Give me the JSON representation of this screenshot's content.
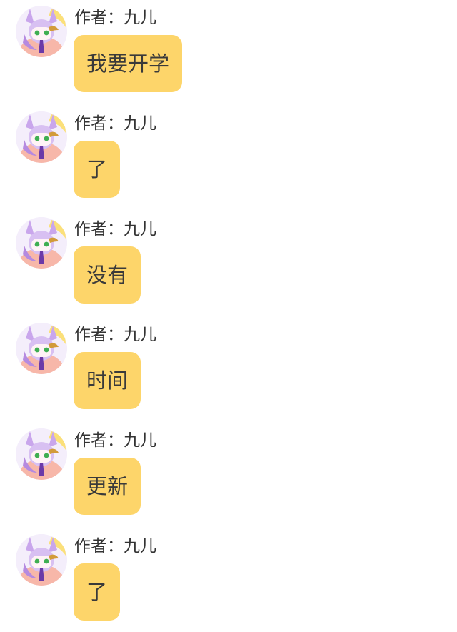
{
  "chat": {
    "messages": [
      {
        "author": "作者：九儿",
        "text": "我要开学"
      },
      {
        "author": "作者：九儿",
        "text": "了"
      },
      {
        "author": "作者：九儿",
        "text": "没有"
      },
      {
        "author": "作者：九儿",
        "text": "时间"
      },
      {
        "author": "作者：九儿",
        "text": "更新"
      },
      {
        "author": "作者：九儿",
        "text": "了"
      }
    ]
  },
  "colors": {
    "bubble": "#fdd56a",
    "author_text": "#333333",
    "bubble_text": "#3a3a3a",
    "background": "#ffffff"
  },
  "icons": {
    "avatar": "anime-cat-girl-avatar"
  }
}
